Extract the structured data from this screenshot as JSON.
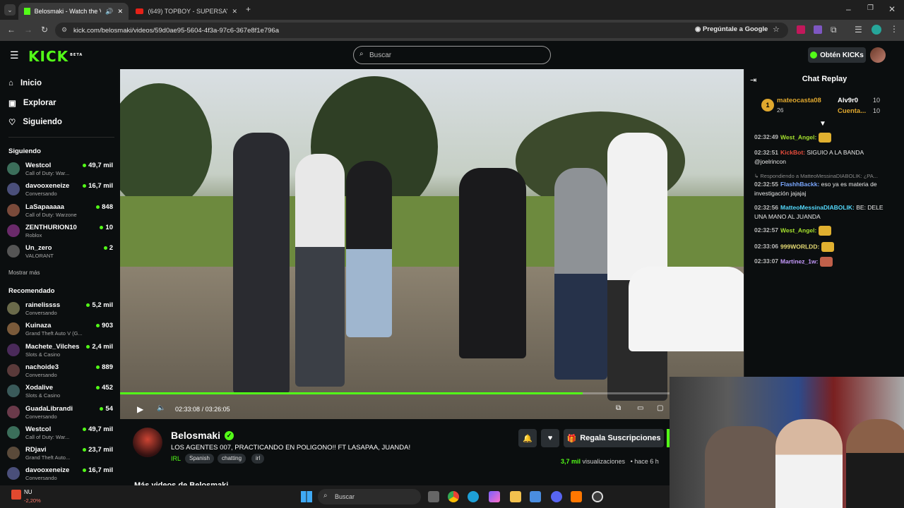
{
  "browser": {
    "tabs": [
      {
        "label": "Belosmaki - Watch the VOD",
        "active": true
      },
      {
        "label": "(649) TOPBOY - SUPERSAYAYIN",
        "active": false
      }
    ],
    "url": "kick.com/belosmaki/videos/59d0ae95-5604-4f3a-97c6-367e8f1e796a",
    "ask_google": "Pregúntale a Google"
  },
  "header": {
    "logo": "KICK",
    "logo_sup": "BETA",
    "search_placeholder": "Buscar",
    "kicks_button": "Obtén KICKs"
  },
  "sidebar": {
    "nav": [
      {
        "label": "Inicio",
        "icon": "home-icon"
      },
      {
        "label": "Explorar",
        "icon": "compass-icon"
      },
      {
        "label": "Siguiendo",
        "icon": "heart-icon"
      }
    ],
    "following_title": "Siguiendo",
    "following": [
      {
        "name": "Westcol",
        "category": "Call of Duty: War...",
        "viewers": "49,7 mil"
      },
      {
        "name": "davooxeneize",
        "category": "Conversando",
        "viewers": "16,7 mil"
      },
      {
        "name": "LaSapaaaaa",
        "category": "Call of Duty: Warzone",
        "viewers": "848"
      },
      {
        "name": "ZENTHURION10",
        "category": "Roblox",
        "viewers": "10"
      },
      {
        "name": "Un_zero",
        "category": "VALORANT",
        "viewers": "2"
      }
    ],
    "show_more": "Mostrar más",
    "recommended_title": "Recomendado",
    "recommended": [
      {
        "name": "rainelissss",
        "category": "Conversando",
        "viewers": "5,2 mil"
      },
      {
        "name": "Kuinaza",
        "category": "Grand Theft Auto V (G...",
        "viewers": "903"
      },
      {
        "name": "Machete_Vilches",
        "category": "Slots & Casino",
        "viewers": "2,4 mil"
      },
      {
        "name": "nachoide3",
        "category": "Conversando",
        "viewers": "889"
      },
      {
        "name": "Xodalive",
        "category": "Slots & Casino",
        "viewers": "452"
      },
      {
        "name": "GuadaLibrandi",
        "category": "Conversando",
        "viewers": "54"
      },
      {
        "name": "Westcol",
        "category": "Call of Duty: War...",
        "viewers": "49,7 mil"
      },
      {
        "name": "RDjavi",
        "category": "Grand Theft Auto...",
        "viewers": "23,7 mil"
      },
      {
        "name": "davooxeneize",
        "category": "Conversando",
        "viewers": "16,7 mil"
      }
    ]
  },
  "video": {
    "current_time": "02:33:08",
    "separator": "/",
    "duration": "03:26:05",
    "progress": 0.742
  },
  "channel": {
    "name": "Belosmaki",
    "title": "LOS AGENTES 007, PRACTICANDO EN POLIGONO!! FT LASAPAA, JUANDA!",
    "category": "IRL",
    "tags": [
      "Spanish",
      "chatting",
      "irl"
    ],
    "gift_button": "Regala Suscripciones",
    "views_count": "3,7 mil",
    "views_label": "visualizaciones",
    "ago": "hace 6 h",
    "more_videos": "Más videos de Belosmaki"
  },
  "chat": {
    "title": "Chat Replay",
    "leaderboard": [
      {
        "rank": "1",
        "name": "mateocasta08",
        "count": "26"
      },
      {
        "name": "Alv9r0",
        "count": "10"
      },
      {
        "name": "Cuenta...",
        "count": "10"
      }
    ],
    "messages": [
      {
        "time": "02:32:49",
        "user": "West_Angel:",
        "text": "",
        "color": "#a6e22e"
      },
      {
        "time": "02:32:51",
        "user": "KickBot:",
        "text": "SIGUIO A LA BANDA @joelrincon",
        "color": "#e74c3c"
      },
      {
        "reply": "Respondiendo a MatteoMessinaDIABOLIK: ¿PA..."
      },
      {
        "time": "02:32:55",
        "user": "FlashhBackk:",
        "text": "eso ya es materia de investigación jajajaj",
        "color": "#7aa7ff"
      },
      {
        "time": "02:32:56",
        "user": "MatteoMessinaDIABOLIK:",
        "text": "BE: DELE UNA MANO AL JUANDA",
        "color": "#53d8fb"
      },
      {
        "time": "02:32:57",
        "user": "West_Angel:",
        "text": "",
        "color": "#a6e22e"
      },
      {
        "time": "02:33:06",
        "user": "999WORLDD:",
        "text": "",
        "color": "#e6db74"
      },
      {
        "time": "02:33:07",
        "user": "Martinez_1w:",
        "text": "",
        "color": "#c79bff"
      }
    ]
  },
  "taskbar": {
    "search": "Buscar",
    "stock_name": "NU",
    "stock_change": "-2,20%"
  },
  "colors": {
    "accent": "#53fc18",
    "bg": "#0b0e0f"
  }
}
